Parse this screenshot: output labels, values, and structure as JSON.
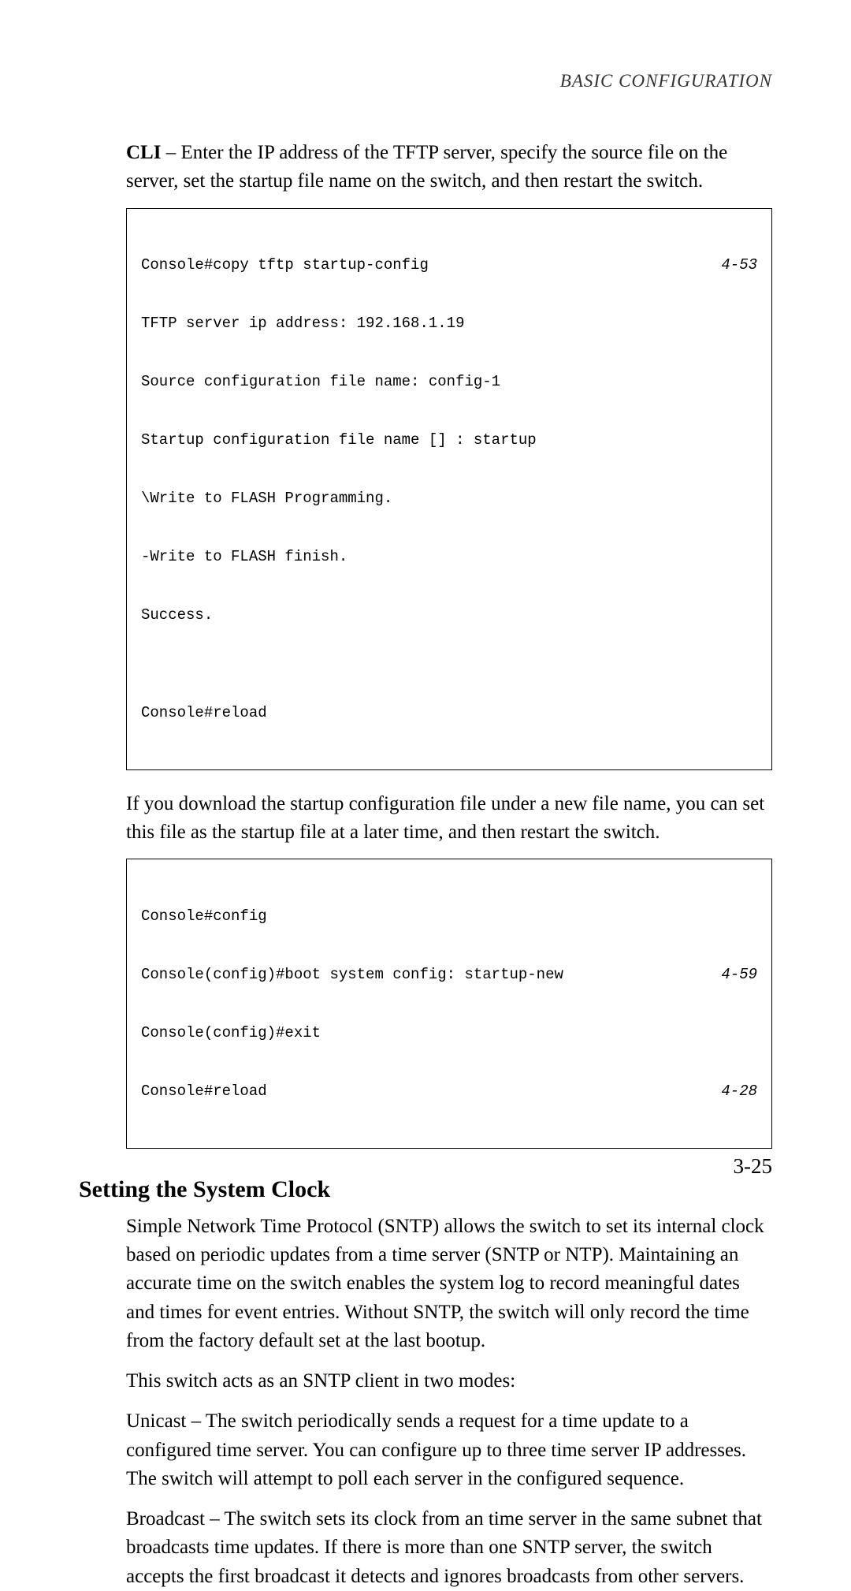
{
  "header": {
    "title": "BASIC CONFIGURATION"
  },
  "para1": {
    "bold": "CLI",
    "text": " – Enter the IP address of the TFTP server, specify the source file on the server, set the startup file name on the switch, and then restart the switch."
  },
  "code1": {
    "line1_left": "Console#copy tftp startup-config",
    "line1_right": "4-53",
    "line2": "TFTP server ip address: 192.168.1.19",
    "line3": "Source configuration file name: config-1",
    "line4": "Startup configuration file name [] : startup",
    "line5": "\\Write to FLASH Programming.",
    "line6": "-Write to FLASH finish.",
    "line7": "Success.",
    "line8": "",
    "line9": "Console#reload"
  },
  "para2": "If you download the startup configuration file under a new file name, you can set this file as the startup file at a later time, and then restart the switch.",
  "code2": {
    "line1": "Console#config",
    "line2_left": "Console(config)#boot system config: startup-new",
    "line2_right": "4-59",
    "line3": "Console(config)#exit",
    "line4_left": "Console#reload",
    "line4_right": "4-28"
  },
  "heading": "Setting the System Clock",
  "para3": "Simple Network Time Protocol (SNTP) allows the switch to set its internal clock based on periodic updates from a time server (SNTP or NTP). Maintaining an accurate time on the switch enables the system log to record meaningful dates and times for event entries. Without SNTP, the switch will only record the time from the factory default set at the last bootup.",
  "para4": "This switch acts as an SNTP client in two modes:",
  "para5": "Unicast – The switch periodically sends a request for a time update to a configured time server. You can configure up to three time server IP addresses. The switch will attempt to poll each server in the configured sequence.",
  "para6": "Broadcast – The switch sets its clock from an time server in the same subnet that broadcasts time updates. If there is more than one SNTP server, the switch accepts the first broadcast it detects and ignores broadcasts from other servers.",
  "pageNumber": "3-25"
}
